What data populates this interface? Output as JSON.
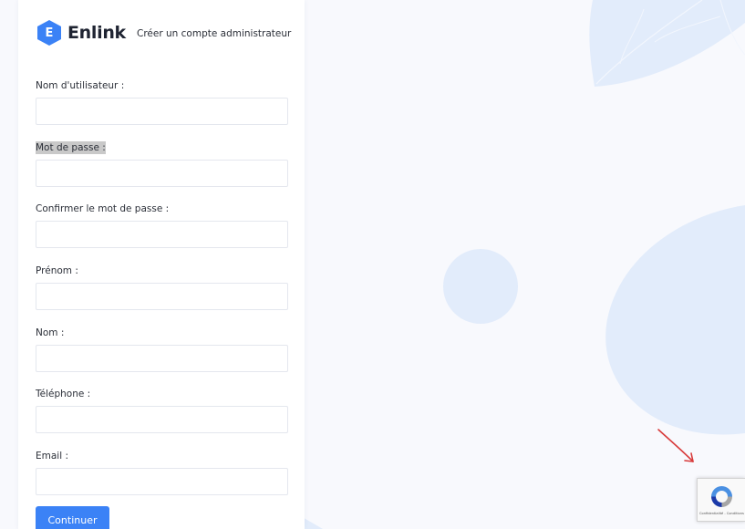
{
  "brand": {
    "logo_letter": "E",
    "name": "Enlink",
    "subtitle": "Créer un compte administrateur"
  },
  "form": {
    "fields": [
      {
        "label": "Nom d'utilisateur :",
        "value": ""
      },
      {
        "label": "Mot de passe :",
        "value": ""
      },
      {
        "label": "Confirmer le mot de passe :",
        "value": ""
      },
      {
        "label": "Prénom :",
        "value": ""
      },
      {
        "label": "Nom :",
        "value": ""
      },
      {
        "label": "Téléphone :",
        "value": ""
      },
      {
        "label": "Email :",
        "value": ""
      }
    ],
    "submit_label": "Continuer"
  },
  "recaptcha": {
    "links_text": "Confidentialité - Conditions"
  },
  "colors": {
    "accent": "#3b82f6",
    "background": "#f8f9fd",
    "shape": "#e2ecfb",
    "annotation": "#d83a3a"
  },
  "icons": {
    "logo": "hexagon-logo-icon",
    "recaptcha": "recaptcha-icon",
    "annotation": "red-arrow-icon"
  }
}
